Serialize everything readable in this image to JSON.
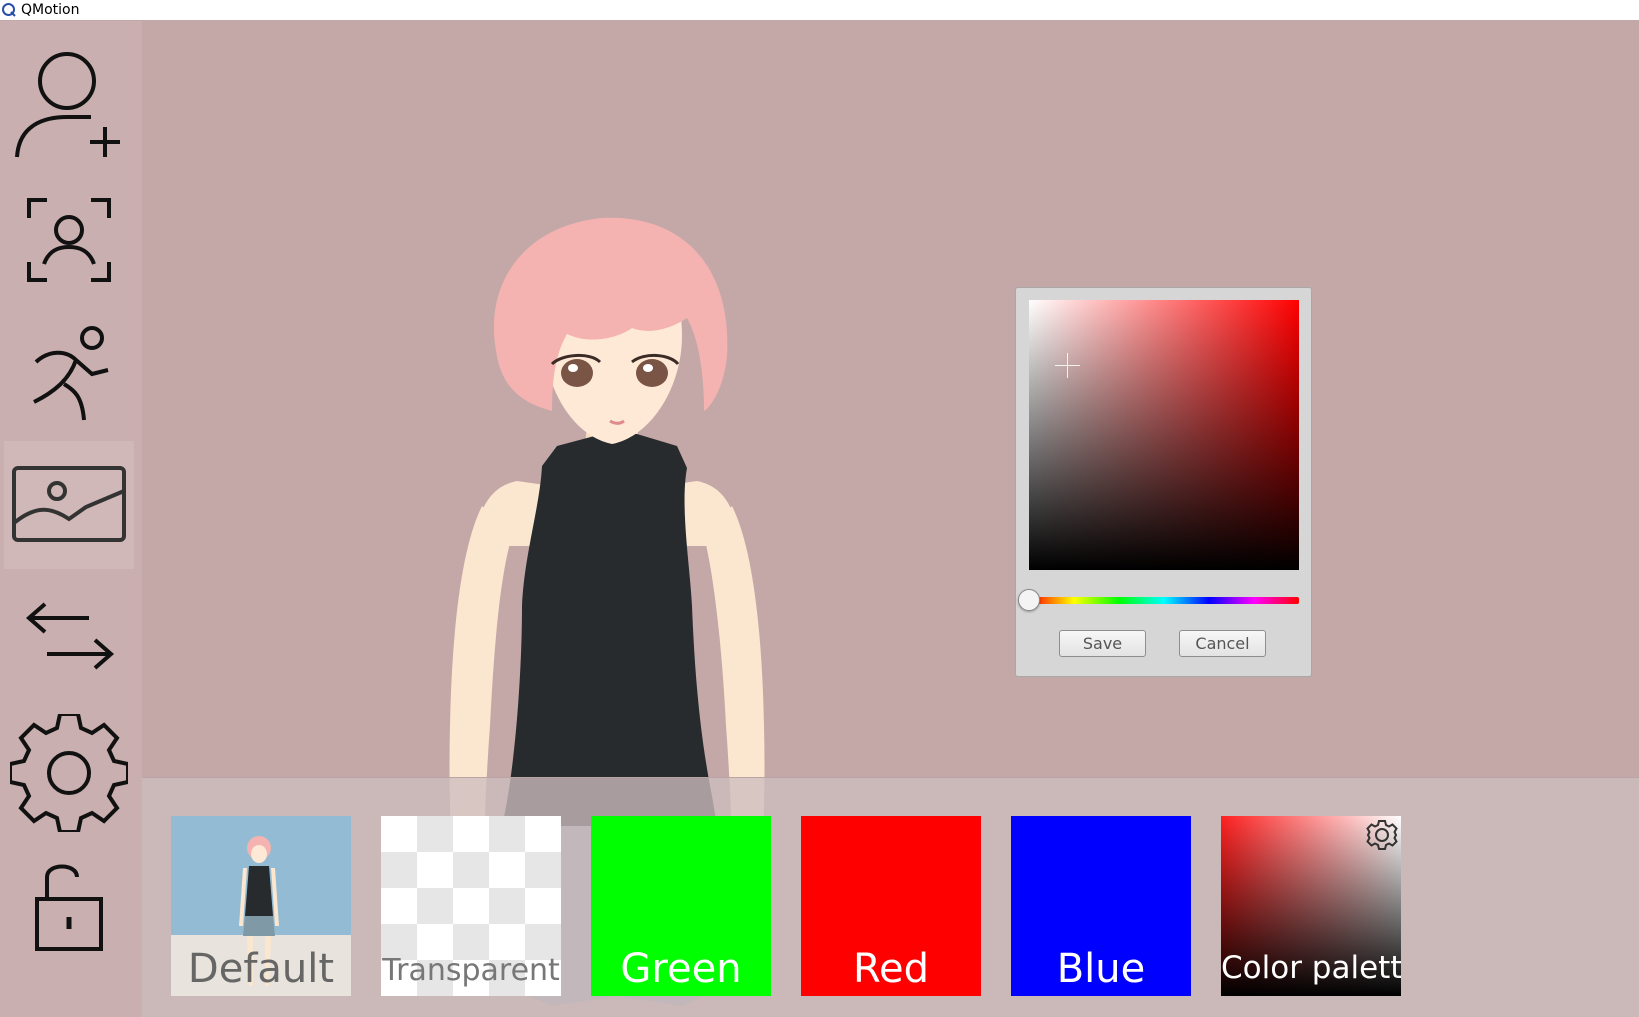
{
  "window": {
    "title": "QMotion",
    "app_icon": "qmotion-logo-icon"
  },
  "sidebar": {
    "items": [
      {
        "name": "add-avatar",
        "icon": "person-add-icon"
      },
      {
        "name": "face-tracking",
        "icon": "face-scan-icon"
      },
      {
        "name": "motion",
        "icon": "running-person-icon"
      },
      {
        "name": "background",
        "icon": "image-icon",
        "active": true
      },
      {
        "name": "switch",
        "icon": "swap-arrows-icon"
      },
      {
        "name": "settings",
        "icon": "gear-icon"
      },
      {
        "name": "lock",
        "icon": "unlocked-padlock-icon"
      }
    ]
  },
  "color_picker": {
    "hue_color": "#ff0000",
    "hue_value": 0,
    "saturation": 0.14,
    "brightness": 0.76,
    "save_label": "Save",
    "cancel_label": "Cancel"
  },
  "backgrounds": [
    {
      "label": "Default",
      "style": "default",
      "label_color": "#666666"
    },
    {
      "label": "Transparent",
      "style": "transparent",
      "label_color": "#777777"
    },
    {
      "label": "Green",
      "style": "green",
      "color": "#00ff00",
      "label_color": "#ffffff"
    },
    {
      "label": "Red",
      "style": "red",
      "color": "#ff0000",
      "label_color": "#ffffff"
    },
    {
      "label": "Blue",
      "style": "blue",
      "color": "#0000ff",
      "label_color": "#ffffff"
    },
    {
      "label": "Color palette",
      "style": "palette",
      "label_color": "#ffffff",
      "icon": "gear-icon"
    }
  ],
  "colors": {
    "viewport_bg": "#c4a8a8",
    "sidebar_bg": "#c9afaf"
  }
}
